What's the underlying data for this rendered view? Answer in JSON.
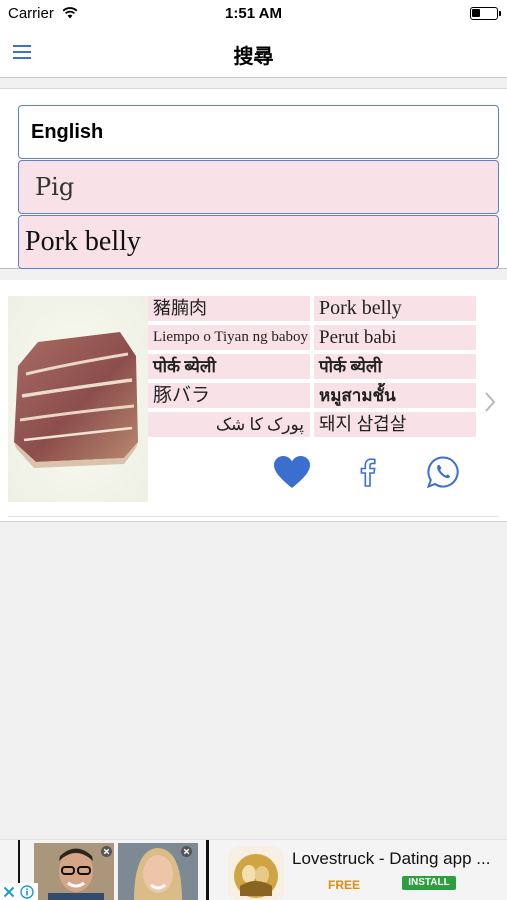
{
  "status_bar": {
    "carrier": "Carrier",
    "time": "1:51 AM"
  },
  "nav": {
    "title": "搜尋",
    "menu_icon": "hamburger-menu-icon"
  },
  "search": {
    "language": "English",
    "word": "Pig",
    "result": "Pork belly",
    "field_border_color": "#5b7fd6",
    "field_fill_color": "#f8e1e7"
  },
  "result_card": {
    "image": "pork-belly-photo",
    "translations": [
      [
        "豬腩肉",
        "Pork belly"
      ],
      [
        "Liempo o Tiyan ng baboy",
        "Perut babi"
      ],
      [
        "पोर्क ब्येली",
        "पोर्क ब्येली"
      ],
      [
        "豚バラ",
        "หมูสามชั้น"
      ],
      [
        "پورک کا شک",
        "돼지 삼겹살"
      ]
    ],
    "actions": [
      "heart-icon",
      "facebook-icon",
      "whatsapp-icon"
    ],
    "next_icon": "chevron-right-icon"
  },
  "ad": {
    "title": "Lovestruck - Dating app ...",
    "price": "FREE",
    "cta": "INSTALL",
    "icons": [
      "close-icon",
      "info-icon"
    ]
  }
}
